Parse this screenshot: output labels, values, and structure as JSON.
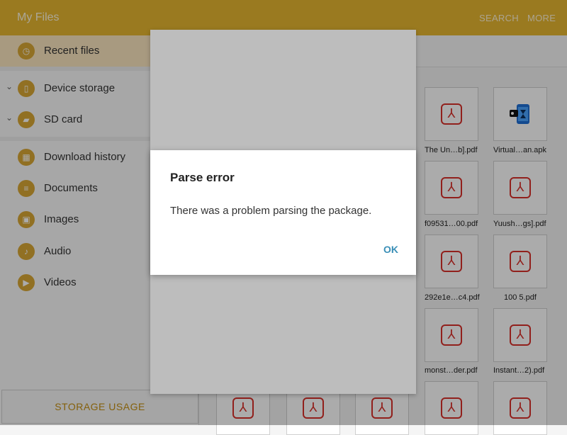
{
  "app": {
    "title": "My Files"
  },
  "toolbar": {
    "search_label": "SEARCH",
    "more_label": "MORE"
  },
  "sidebar": {
    "items": [
      {
        "label": "Recent files",
        "icon": "clock-icon"
      },
      {
        "label": "Device storage",
        "icon": "phone-icon"
      },
      {
        "label": "SD card",
        "icon": "sd-card-icon"
      },
      {
        "label": "Download history",
        "icon": "download-icon"
      },
      {
        "label": "Documents",
        "icon": "document-icon"
      },
      {
        "label": "Images",
        "icon": "image-icon"
      },
      {
        "label": "Audio",
        "icon": "music-note-icon"
      },
      {
        "label": "Videos",
        "icon": "video-icon"
      }
    ],
    "storage_usage_label": "STORAGE USAGE"
  },
  "files": [
    {
      "name": "The Un…b].pdf",
      "type": "pdf"
    },
    {
      "name": "Virtual…an.apk",
      "type": "apk"
    },
    {
      "name": "f09531…00.pdf",
      "type": "pdf"
    },
    {
      "name": "Yuush…gs].pdf",
      "type": "pdf"
    },
    {
      "name": "292e1e…c4.pdf",
      "type": "pdf"
    },
    {
      "name": "100 5.pdf",
      "type": "pdf"
    },
    {
      "name": "monst…der.pdf",
      "type": "pdf"
    },
    {
      "name": "Instant…2).pdf",
      "type": "pdf"
    }
  ],
  "dialog": {
    "title": "Parse error",
    "message": "There was a problem parsing the package.",
    "ok_label": "OK"
  },
  "colors": {
    "accent": "#e6b630",
    "pdf": "#d9302a",
    "dialog_button": "#3a8fb7"
  }
}
